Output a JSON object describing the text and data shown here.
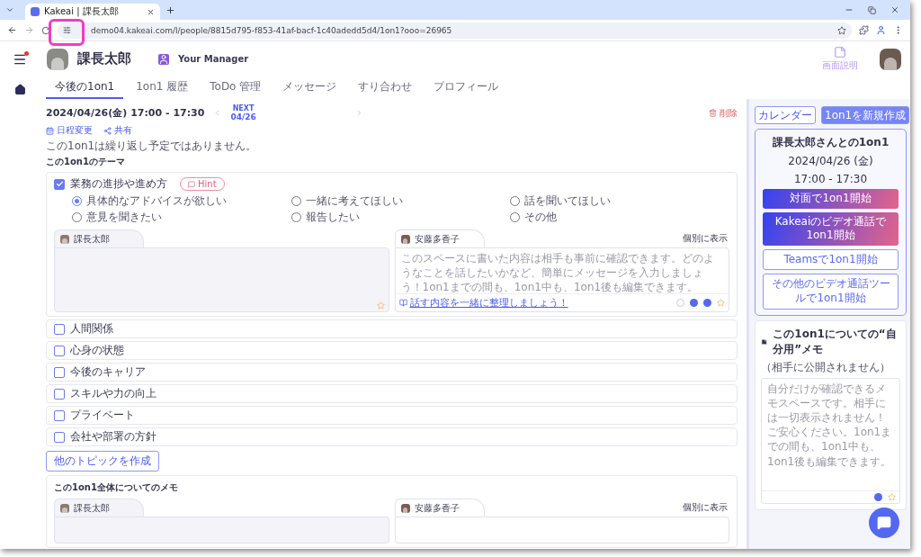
{
  "browser": {
    "tab_title": "Kakeai | 課長太郎",
    "url": "demo04.kakeai.com/l/people/8815d795-f853-41af-bacf-1c40adedd5d4/1on1?ooo=26965",
    "site_info_highlighted": true
  },
  "header": {
    "name": "課長太郎",
    "role": "Your Manager",
    "help_label": "画面説明",
    "menu_notification": true
  },
  "tabs": [
    {
      "label": "今後の1on1",
      "selected": true
    },
    {
      "label": "1on1 履歴",
      "selected": false
    },
    {
      "label": "ToDo 管理",
      "selected": false
    },
    {
      "label": "メッセージ",
      "selected": false
    },
    {
      "label": "すり合わせ",
      "selected": false
    },
    {
      "label": "プロフィール",
      "selected": false
    }
  ],
  "meeting": {
    "datetime": "2024/04/26(金) 17:00 - 17:30",
    "next_label": "NEXT",
    "next_date": "04/26",
    "reschedule": "日程変更",
    "share": "共有",
    "delete": "削除",
    "repeat_note": "この1on1は繰り返し予定ではありません。"
  },
  "themes": {
    "title": "この1on1のテーマ",
    "add_button": "他のトピックを作成",
    "items": [
      {
        "label": "業務の進捗や進め方",
        "checked": true,
        "hint": "Hint",
        "toggle_label": "個別に表示",
        "options": [
          {
            "label": "具体的なアドバイスが欲しい",
            "selected": true
          },
          {
            "label": "一緒に考えてほしい",
            "selected": false
          },
          {
            "label": "話を聞いてほしい",
            "selected": false
          },
          {
            "label": "意見を聞きたい",
            "selected": false
          },
          {
            "label": "報告したい",
            "selected": false
          },
          {
            "label": "その他",
            "selected": false
          }
        ],
        "memos": [
          {
            "author": "課長太郎",
            "kind": "self"
          },
          {
            "author": "安藤多香子",
            "kind": "partner",
            "placeholder": "このスペースに書いた内容は相手も事前に確認できます。どのようなことを話したいかなど、簡単にメッセージを入力しましょう！1on1までの間も、1on1中も、1on1後も編集できます。",
            "helper_link": "話す内容を一緒に整理しましょう！"
          }
        ]
      },
      {
        "label": "人間関係",
        "checked": false
      },
      {
        "label": "心身の状態",
        "checked": false
      },
      {
        "label": "今後のキャリア",
        "checked": false
      },
      {
        "label": "スキルや力の向上",
        "checked": false
      },
      {
        "label": "プライベート",
        "checked": false
      },
      {
        "label": "会社や部署の方針",
        "checked": false
      }
    ]
  },
  "overall_memo": {
    "title": "この1on1全体についてのメモ",
    "toggle_label": "個別に表示",
    "memos": [
      {
        "author": "課長太郎",
        "kind": "self"
      },
      {
        "author": "安藤多香子",
        "kind": "partner"
      }
    ]
  },
  "sidebar": {
    "calendar_button": "カレンダー",
    "new_button": "1on1を新規作成",
    "card": {
      "title": "課長太郎さんとの1on1",
      "date": "2024/04/26 (金)",
      "time": "17:00 - 17:30",
      "actions": [
        {
          "label": "対面で1on1開始",
          "kind": "primary"
        },
        {
          "label": "Kakeaiのビデオ通話で1on1開始",
          "kind": "primary"
        },
        {
          "label": "Teamsで1on1開始",
          "kind": "outline"
        },
        {
          "label": "その他のビデオ通話ツールで1on1開始",
          "kind": "outline"
        }
      ]
    },
    "private_memo": {
      "title": "この1on1についての“自分用”メモ",
      "subtitle": "（相手に公開されません）",
      "placeholder": "自分だけが確認できるメモスペースです。相手には一切表示されません！ご安心ください。1on1までの間も、1on1中も、1on1後も編集できます。"
    }
  }
}
